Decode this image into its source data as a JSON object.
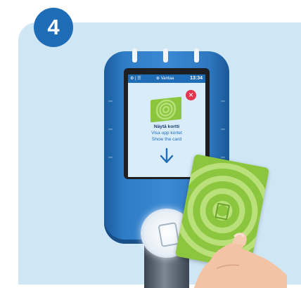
{
  "step": {
    "number": "4"
  },
  "reader": {
    "status_bar": {
      "icons": "⚙ | ☰",
      "operator": "⊕ Vantaa",
      "time": "13:34"
    },
    "screen": {
      "close_icon": "close-icon",
      "title_fi": "Näytä kortti",
      "title_sv": "Visa upp kortet",
      "title_en": "Show the card",
      "arrow_icon": "arrow-down-icon"
    }
  },
  "colors": {
    "panel_bg": "#cfe6f5",
    "badge": "#1f6db6",
    "reader_body": "#2f7cc6",
    "screen_bg": "#d9ecfa",
    "card_green": "#8cc63e",
    "close_red": "#e2354e"
  }
}
